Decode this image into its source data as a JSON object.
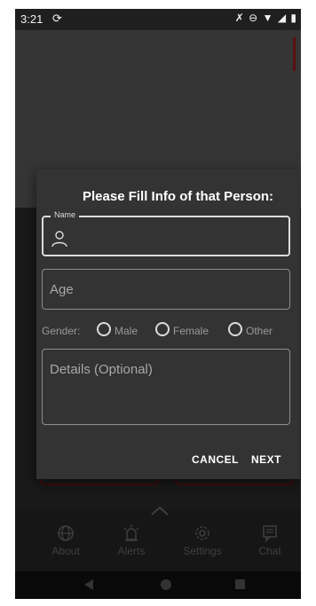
{
  "status_bar": {
    "time": "3:21",
    "sync_icon": "sync-icon",
    "right_icons": "alarm-off, do-not-disturb, wifi, signal, battery"
  },
  "dialog": {
    "title": "Please Fill Info of that Person:",
    "name_field": {
      "label": "Name",
      "value": "",
      "icon": "person-icon"
    },
    "age_field": {
      "placeholder": "Age",
      "value": ""
    },
    "gender": {
      "label": "Gender:",
      "options": [
        "Male",
        "Female",
        "Other"
      ],
      "selected": null
    },
    "details_field": {
      "placeholder": "Details (Optional)",
      "value": ""
    },
    "cancel_label": "CANCEL",
    "next_label": "NEXT"
  },
  "bottom_nav": {
    "tabs": [
      {
        "label": "About",
        "icon": "globe-icon"
      },
      {
        "label": "Alerts",
        "icon": "siren-icon"
      },
      {
        "label": "Settings",
        "icon": "gear-icon"
      },
      {
        "label": "Chat",
        "icon": "chat-icon"
      }
    ]
  },
  "colors": {
    "dialog_bg": "#333333",
    "accent_dark_red": "#7a1414",
    "text_primary": "#ffffff",
    "text_hint": "#a8a8a8"
  }
}
